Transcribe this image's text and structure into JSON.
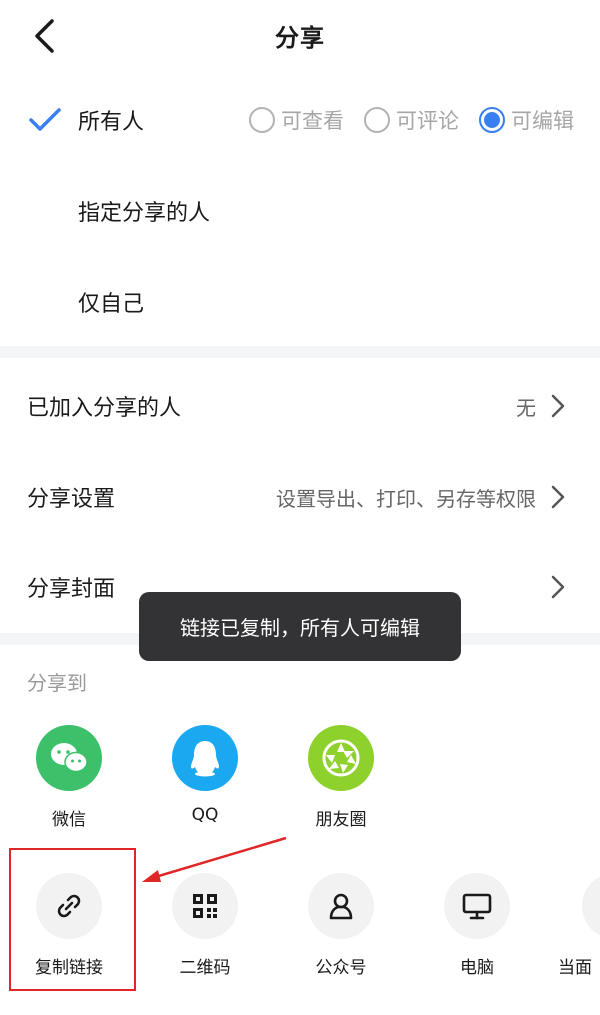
{
  "header": {
    "title": "分享"
  },
  "share_scope": {
    "options": [
      {
        "label": "所有人",
        "selected": true
      },
      {
        "label": "指定分享的人",
        "selected": false
      },
      {
        "label": "仅自己",
        "selected": false
      }
    ],
    "permissions": [
      {
        "label": "可查看",
        "checked": false
      },
      {
        "label": "可评论",
        "checked": false
      },
      {
        "label": "可编辑",
        "checked": true
      }
    ]
  },
  "settings": [
    {
      "label": "已加入分享的人",
      "value": "无"
    },
    {
      "label": "分享设置",
      "value": "设置导出、打印、另存等权限"
    },
    {
      "label": "分享封面",
      "value": ""
    }
  ],
  "toast": "链接已复制，所有人可编辑",
  "share_to": {
    "title": "分享到",
    "apps": [
      {
        "label": "微信",
        "icon": "wechat-icon",
        "color": "#3cc06a"
      },
      {
        "label": "QQ",
        "icon": "qq-icon",
        "color": "#1aa9f0"
      },
      {
        "label": "朋友圈",
        "icon": "moments-icon",
        "color": "#8fd12c"
      }
    ],
    "tools": [
      {
        "label": "复制链接",
        "icon": "link-icon"
      },
      {
        "label": "二维码",
        "icon": "qrcode-icon"
      },
      {
        "label": "公众号",
        "icon": "official-account-icon"
      },
      {
        "label": "电脑",
        "icon": "computer-icon"
      },
      {
        "label": "当面",
        "icon": "face-to-face-icon"
      }
    ]
  },
  "colors": {
    "accent": "#3a7ff0",
    "highlight": "#e02626",
    "divider": "#f4f5f7"
  }
}
